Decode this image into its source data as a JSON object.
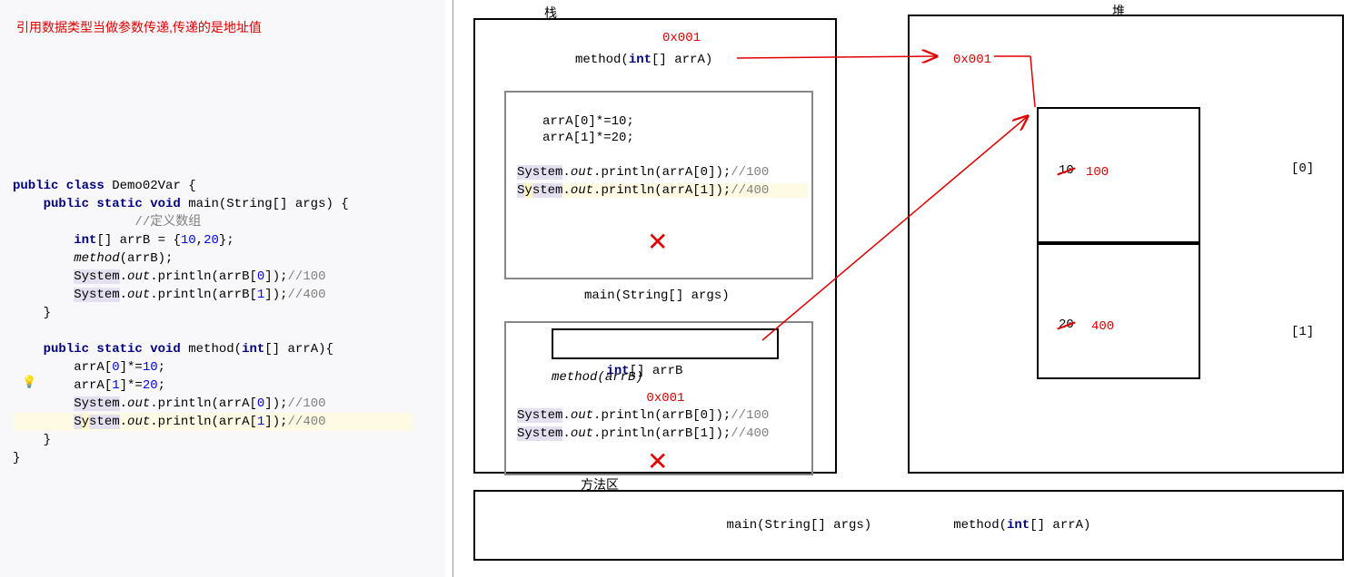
{
  "title": "引用数据类型当做参数传递,传递的是地址值",
  "code": {
    "classDecl": "public class Demo02Var {",
    "mainDecl": "    public static void main(String[] args) {",
    "comment1": "        //定义数组",
    "arrBDecl": "        int[] arrB = {10,20};",
    "callMethod": "        method(arrB);",
    "printB0": "        System.out.println(arrB[0]);//100",
    "printB1": "        System.out.println(arrB[1]);//400",
    "closeMain": "    }",
    "blank": "",
    "methodDecl": "    public static void method(int[] arrA){",
    "arrA0": "        arrA[0]*=10;",
    "arrA1": "        arrA[1]*=20;",
    "printA0": "        System.out.println(arrA[0]);//100",
    "printA1": "        System.out.println(arrA[1]);//400",
    "closeMethod": "    }",
    "closeClass": "}"
  },
  "labels": {
    "stack": "栈",
    "heap": "堆",
    "methodArea": "方法区"
  },
  "addresses": {
    "addr": "0x001"
  },
  "stack": {
    "methodSig": "method(int[] arrA)",
    "arrA0": "arrA[0]*=10;",
    "arrA1": "arrA[1]*=20;",
    "pA0": "System.out.println(arrA[0]);//100",
    "pA1": "System.out.println(arrA[1]);//400",
    "mainSig": "main(String[] args)",
    "arrBDecl": "int[] arrB",
    "callMethod": "method(arrB)",
    "pB0": "System.out.println(arrB[0]);//100",
    "pB1": "System.out.println(arrB[1]);//400"
  },
  "heap": {
    "old0": "10",
    "new0": "100",
    "old1": "20",
    "new1": "400",
    "idx0": "[0]",
    "idx1": "[1]"
  },
  "methodArea": {
    "mainSig": "main(String[] args)",
    "methodSig": "method(int[] arrA)"
  }
}
